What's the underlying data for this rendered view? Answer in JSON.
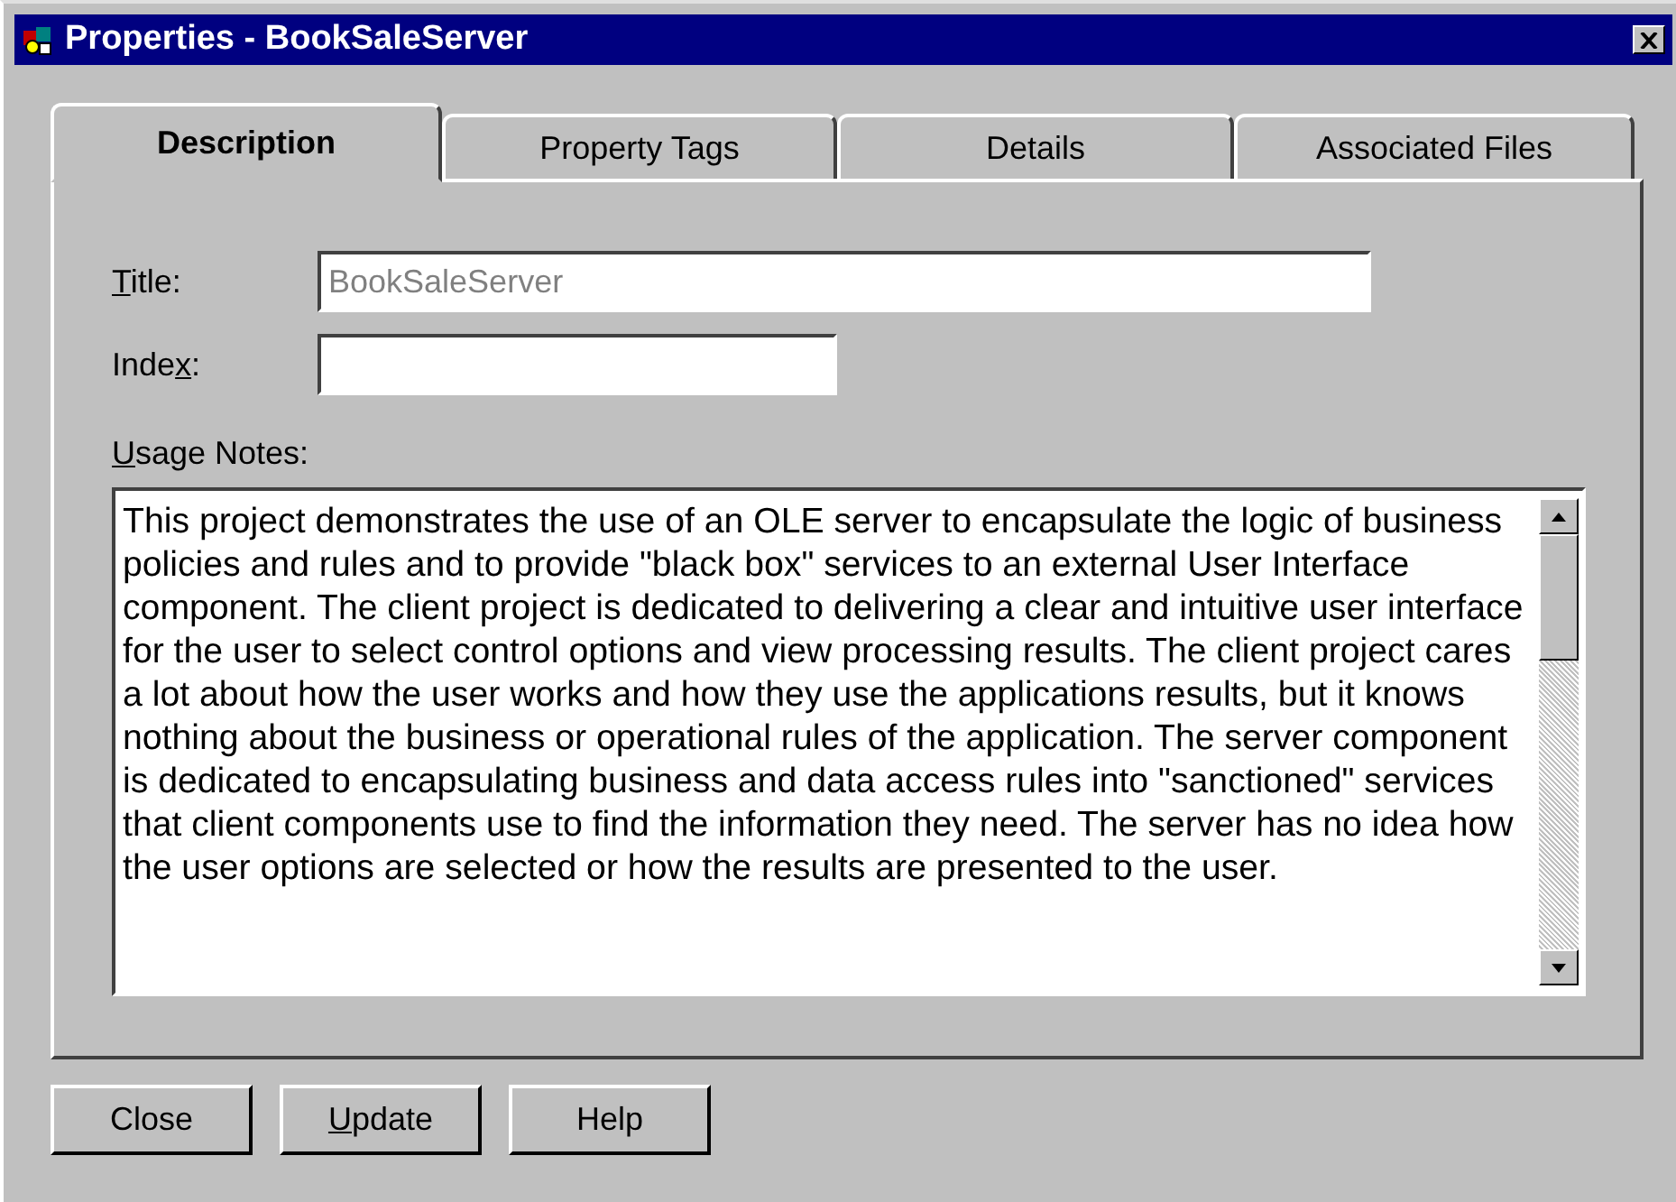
{
  "window": {
    "title": "Properties - BookSaleServer"
  },
  "tabs": [
    {
      "label": "Description",
      "selected": true
    },
    {
      "label": "Property Tags",
      "selected": false
    },
    {
      "label": "Details",
      "selected": false
    },
    {
      "label": "Associated Files",
      "selected": false
    }
  ],
  "fields": [
    {
      "label_parts": [
        {
          "text": "T",
          "underlined": true
        },
        {
          "text": "itle:",
          "underlined": false
        }
      ],
      "value": "BookSaleServer",
      "disabled": true
    },
    {
      "label_parts": [
        {
          "text": "Inde",
          "underlined": false
        },
        {
          "text": "x",
          "underlined": true
        },
        {
          "text": ":",
          "underlined": false
        }
      ]
    }
  ],
  "usage_notes": {
    "label_parts": [
      {
        "text": "U",
        "underlined": true
      },
      {
        "text": "sage Notes:",
        "underlined": false
      }
    ],
    "value": "This project demonstrates the use of an OLE server to encapsulate the logic of business policies and rules and to provide \"black box\" services to an external User Interface component.  The client project is dedicated to delivering a clear and intuitive user interface for the user to select control options and view processing results.   The client project cares a lot about how the user works and how they use the applications results, but it knows nothing about the business or operational rules of the application.  The server component is dedicated to encapsulating business and data access rules into \"sanctioned\" services that client components use to find the information they need.  The server has no idea how the user options are selected or how the results are presented to the user."
  },
  "buttons": [
    {
      "label_parts": [
        {
          "text": "Close",
          "underlined": false
        }
      ]
    },
    {
      "label_parts": [
        {
          "text": "U",
          "underlined": true
        },
        {
          "text": "pdate",
          "underlined": false
        }
      ]
    },
    {
      "label_parts": [
        {
          "text": "Help",
          "underlined": false
        }
      ]
    }
  ]
}
